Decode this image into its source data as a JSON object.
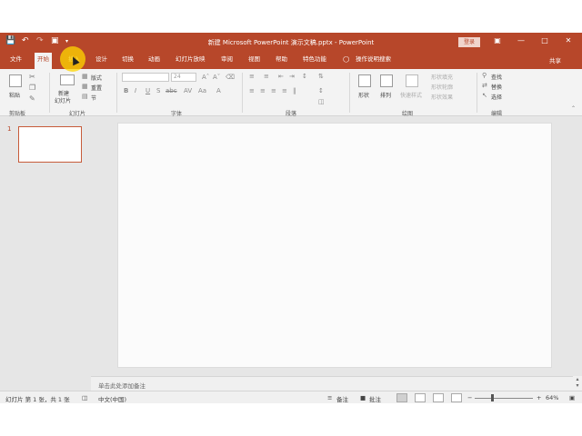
{
  "window": {
    "title": "新建 Microsoft PowerPoint 演示文稿.pptx  -  PowerPoint",
    "login_label": "登录",
    "share_label": "共享"
  },
  "quick_access": {
    "save_icon": "save-icon",
    "undo_icon": "undo-icon",
    "redo_icon": "redo-icon",
    "start_icon": "slideshow-start-icon"
  },
  "tabs": [
    {
      "label": "文件"
    },
    {
      "label": "开始",
      "active": true
    },
    {
      "label": "插入"
    },
    {
      "label": "设计"
    },
    {
      "label": "切换"
    },
    {
      "label": "动画"
    },
    {
      "label": "幻灯片放映"
    },
    {
      "label": "审阅"
    },
    {
      "label": "视图"
    },
    {
      "label": "帮助"
    },
    {
      "label": "特色功能"
    }
  ],
  "tell_me": "操作说明搜索",
  "ribbon": {
    "clipboard": {
      "paste": "粘贴",
      "label": "剪贴板"
    },
    "slides": {
      "new_slide_top": "新建",
      "new_slide_bottom": "幻灯片",
      "layout": "版式",
      "reset": "重置",
      "section": "节",
      "label": "幻灯片"
    },
    "font": {
      "size": "24",
      "label": "字体"
    },
    "paragraph": {
      "label": "段落"
    },
    "drawing": {
      "shapes": "形状",
      "arrange": "排列",
      "quick_styles": "快速样式",
      "fill": "形状填充",
      "outline": "形状轮廓",
      "effects": "形状效果",
      "label": "绘图"
    },
    "editing": {
      "find": "查找",
      "replace": "替换",
      "select": "选择",
      "label": "编辑"
    }
  },
  "slide_panel": {
    "number": "1"
  },
  "notes": {
    "placeholder": "单击此处添加备注"
  },
  "status": {
    "slide_info": "幻灯片 第 1 张，共 1 张",
    "language": "中文(中国)",
    "notes_btn": "备注",
    "comments_btn": "批注",
    "zoom": "64%",
    "zoom_fraction": 0.64
  },
  "colors": {
    "brand": "#b7472a",
    "ribbon_bg": "#f3f3f3",
    "workspace_bg": "#e6e6e6"
  }
}
